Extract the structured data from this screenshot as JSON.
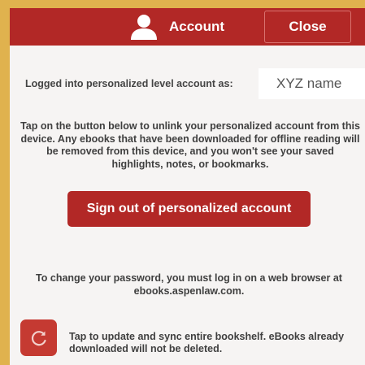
{
  "header": {
    "title": "Account",
    "close_label": "Close",
    "icon": "user-icon"
  },
  "account": {
    "logged_in_label": "Logged into personalized level account as:",
    "account_name": "XYZ name"
  },
  "unlink": {
    "description": "Tap on the button below to unlink your personalized account from this device. Any ebooks that have been downloaded for offline reading will be removed from this device, and you won't see your saved highlights, notes, or bookmarks.",
    "signout_label": "Sign out of personalized account"
  },
  "password": {
    "line1": "To change your password, you must log in on a web browser at",
    "line2": "ebooks.aspenlaw.com."
  },
  "sync": {
    "icon": "refresh-icon",
    "description": "Tap to update and sync entire bookshelf. eBooks already downloaded will not be deleted."
  },
  "colors": {
    "brand_red": "#b22826",
    "backdrop_gold": "#e0b24e",
    "panel_bg": "#f6f4f3"
  }
}
